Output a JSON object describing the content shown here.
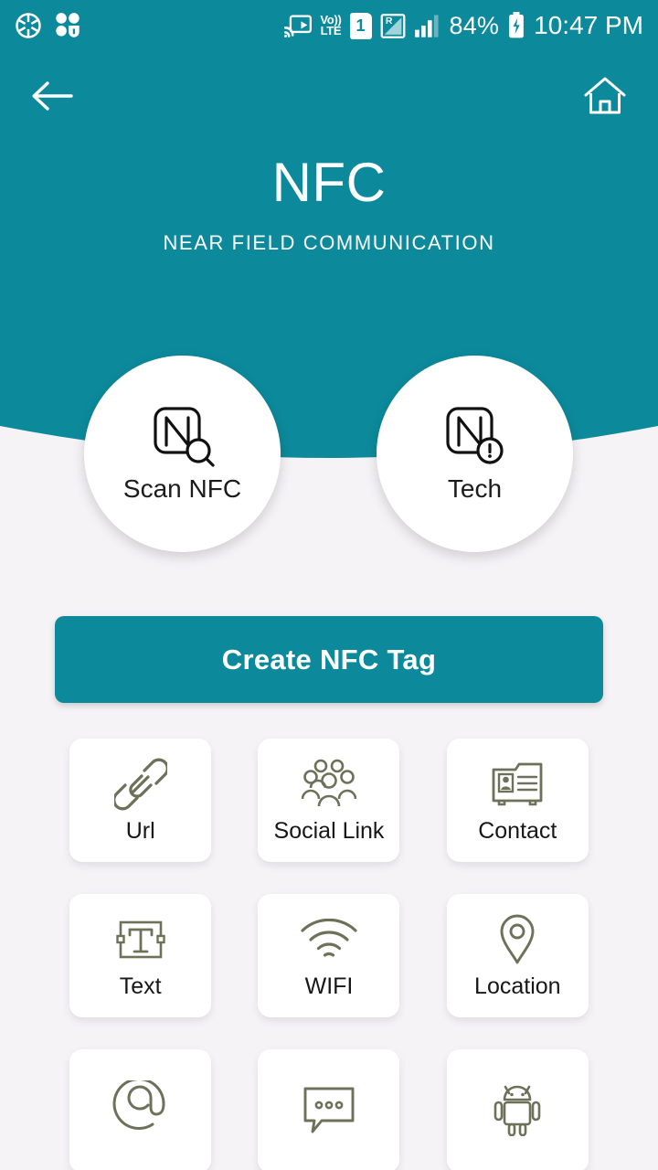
{
  "status_bar": {
    "left_icons": [
      {
        "name": "camera-aperture-icon",
        "glyph": "aperture"
      },
      {
        "name": "app-grid-badge-icon",
        "glyph": "grid-badge"
      }
    ],
    "cast_icon": "screen-cast-icon",
    "volte_top": "Vo))",
    "volte_bottom": "LTE",
    "sim_slot": "1",
    "roaming_icon": "R",
    "signal_icon": "signal-bars-icon",
    "battery_percent": "84%",
    "battery_icon": "battery-charging-icon",
    "time": "10:47 PM"
  },
  "nav": {
    "back_label": "back-arrow",
    "home_label": "home"
  },
  "header": {
    "title": "NFC",
    "subtitle": "NEAR FIELD COMMUNICATION"
  },
  "circle_actions": [
    {
      "label": "Scan NFC",
      "icon": "nfc-scan-icon"
    },
    {
      "label": "Tech",
      "icon": "nfc-info-icon"
    }
  ],
  "cta": {
    "label": "Create NFC Tag"
  },
  "tiles": [
    {
      "label": "Url",
      "icon": "link-icon"
    },
    {
      "label": "Social Link",
      "icon": "people-group-icon"
    },
    {
      "label": "Contact",
      "icon": "contact-card-icon"
    },
    {
      "label": "Text",
      "icon": "text-box-icon"
    },
    {
      "label": "WIFI",
      "icon": "wifi-icon"
    },
    {
      "label": "Location",
      "icon": "map-pin-icon"
    },
    {
      "label": "",
      "icon": "email-at-icon"
    },
    {
      "label": "",
      "icon": "sms-bubble-icon"
    },
    {
      "label": "",
      "icon": "android-robot-icon"
    }
  ],
  "colors": {
    "primary_teal": "#0c8a9c",
    "page_background": "#f5f3f6",
    "tile_background": "#ffffff",
    "icon_stroke": "#6e7159",
    "text_dark": "#171717"
  }
}
